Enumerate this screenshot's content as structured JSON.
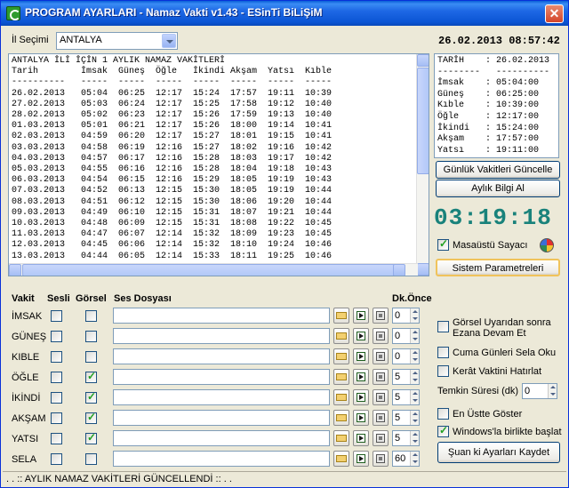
{
  "window": {
    "title": "PROGRAM AYARLARI - Namaz Vakti v1.43 - ESinTi BiLiŞiM",
    "close_glyph": "✕"
  },
  "city": {
    "label": "İl Seçimi",
    "value": "ANTALYA"
  },
  "datetime": "26.02.2013  08:57:42",
  "monthly": {
    "heading": "ANTALYA İLİ İÇİN 1 AYLIK NAMAZ VAKİTLERİ",
    "columns": [
      "Tarih",
      "İmsak",
      "Güneş",
      "Öğle",
      "İkindi",
      "Akşam",
      "Yatsı",
      "Kıble"
    ],
    "separator": [
      "----------",
      "-----",
      "-----",
      "-----",
      "-----",
      "-----",
      "-----",
      "-----"
    ],
    "rows": [
      [
        "26.02.2013",
        "05:04",
        "06:25",
        "12:17",
        "15:24",
        "17:57",
        "19:11",
        "10:39"
      ],
      [
        "27.02.2013",
        "05:03",
        "06:24",
        "12:17",
        "15:25",
        "17:58",
        "19:12",
        "10:40"
      ],
      [
        "28.02.2013",
        "05:02",
        "06:23",
        "12:17",
        "15:26",
        "17:59",
        "19:13",
        "10:40"
      ],
      [
        "01.03.2013",
        "05:01",
        "06:21",
        "12:17",
        "15:26",
        "18:00",
        "19:14",
        "10:41"
      ],
      [
        "02.03.2013",
        "04:59",
        "06:20",
        "12:17",
        "15:27",
        "18:01",
        "19:15",
        "10:41"
      ],
      [
        "03.03.2013",
        "04:58",
        "06:19",
        "12:16",
        "15:27",
        "18:02",
        "19:16",
        "10:42"
      ],
      [
        "04.03.2013",
        "04:57",
        "06:17",
        "12:16",
        "15:28",
        "18:03",
        "19:17",
        "10:42"
      ],
      [
        "05.03.2013",
        "04:55",
        "06:16",
        "12:16",
        "15:28",
        "18:04",
        "19:18",
        "10:43"
      ],
      [
        "06.03.2013",
        "04:54",
        "06:15",
        "12:16",
        "15:29",
        "18:05",
        "19:19",
        "10:43"
      ],
      [
        "07.03.2013",
        "04:52",
        "06:13",
        "12:15",
        "15:30",
        "18:05",
        "19:19",
        "10:44"
      ],
      [
        "08.03.2013",
        "04:51",
        "06:12",
        "12:15",
        "15:30",
        "18:06",
        "19:20",
        "10:44"
      ],
      [
        "09.03.2013",
        "04:49",
        "06:10",
        "12:15",
        "15:31",
        "18:07",
        "19:21",
        "10:44"
      ],
      [
        "10.03.2013",
        "04:48",
        "06:09",
        "12:15",
        "15:31",
        "18:08",
        "19:22",
        "10:45"
      ],
      [
        "11.03.2013",
        "04:47",
        "06:07",
        "12:14",
        "15:32",
        "18:09",
        "19:23",
        "10:45"
      ],
      [
        "12.03.2013",
        "04:45",
        "06:06",
        "12:14",
        "15:32",
        "18:10",
        "19:24",
        "10:46"
      ],
      [
        "13.03.2013",
        "04:44",
        "06:05",
        "12:14",
        "15:33",
        "18:11",
        "19:25",
        "10:46"
      ]
    ]
  },
  "today": {
    "rows": [
      [
        "TARİH",
        ":",
        "26.02.2013"
      ],
      [
        "--------",
        "",
        "----------"
      ],
      [
        "İmsak",
        ":",
        "05:04:00"
      ],
      [
        "Güneş",
        ":",
        "06:25:00"
      ],
      [
        "Kıble",
        ":",
        "10:39:00"
      ],
      [
        "Öğle",
        ":",
        "12:17:00"
      ],
      [
        "İkindi",
        ":",
        "15:24:00"
      ],
      [
        "Akşam",
        ":",
        "17:57:00"
      ],
      [
        "Yatsı",
        ":",
        "19:11:00"
      ]
    ]
  },
  "buttons": {
    "update_daily": "Günlük Vakitleri Güncelle",
    "monthly_info": "Aylık Bilgi Al",
    "system_params": "Sistem Parametreleri",
    "save_settings": "Şuan ki Ayarları Kaydet"
  },
  "countdown": "03:19:18",
  "desktop_counter": {
    "label": "Masaüstü Sayacı",
    "checked": true
  },
  "vakit_table": {
    "headers": {
      "vakit": "Vakit",
      "sesli": "Sesli",
      "gorsel": "Görsel",
      "ses_dosyasi": "Ses Dosyası",
      "dk_once": "Dk.Önce"
    },
    "rows": [
      {
        "name": "İMSAK",
        "sesli": false,
        "gorsel": false,
        "dk": "0"
      },
      {
        "name": "GÜNEŞ",
        "sesli": false,
        "gorsel": false,
        "dk": "0"
      },
      {
        "name": "KIBLE",
        "sesli": false,
        "gorsel": false,
        "dk": "0"
      },
      {
        "name": "ÖĞLE",
        "sesli": false,
        "gorsel": true,
        "dk": "5"
      },
      {
        "name": "İKİNDİ",
        "sesli": false,
        "gorsel": true,
        "dk": "5"
      },
      {
        "name": "AKŞAM",
        "sesli": false,
        "gorsel": true,
        "dk": "5"
      },
      {
        "name": "YATSI",
        "sesli": false,
        "gorsel": true,
        "dk": "5"
      },
      {
        "name": "SELA",
        "sesli": false,
        "gorsel": false,
        "dk": "60"
      }
    ]
  },
  "options": {
    "visual_warning": "Görsel Uyarıdan sonra Ezana Devam Et",
    "friday_sela": "Cuma Günleri Sela Oku",
    "kerat": "Kerât Vaktini Hatırlat",
    "temkin_label": "Temkin Süresi (dk) :",
    "temkin_value": "0",
    "always_on_top": "En Üstte Göster",
    "start_with_windows": "Windows'la birlikte başlat",
    "visual_warning_checked": false,
    "friday_sela_checked": false,
    "kerat_checked": false,
    "always_on_top_checked": false,
    "start_with_windows_checked": true
  },
  "status": ". . :: AYLIK NAMAZ VAKİTLERİ GÜNCELLENDİ :: . ."
}
